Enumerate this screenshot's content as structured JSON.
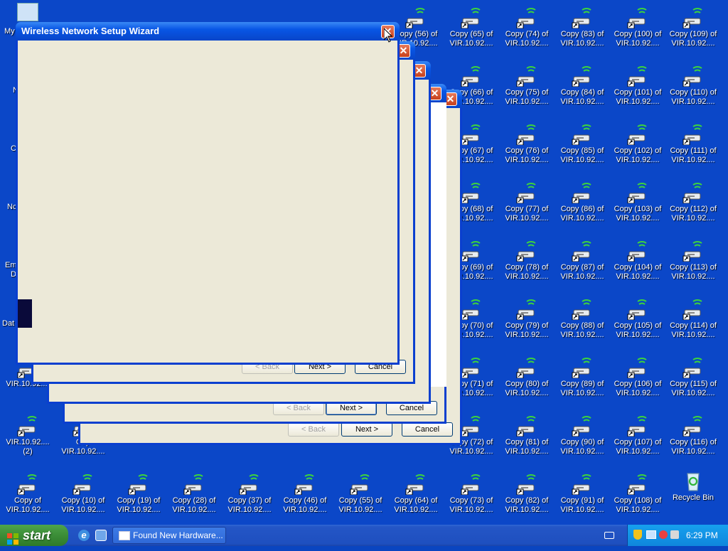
{
  "desktop": {
    "partial_labels": [
      "My",
      "N",
      "C",
      "Nc",
      "Em",
      "D",
      "Dat"
    ],
    "icons_row1": [
      "Copy (56) of",
      "Copy (65) of",
      "Copy (74) of",
      "Copy (83) of",
      "Copy (100) of",
      "Copy (109) of"
    ],
    "icons_col_y": [
      [
        "Copy (66) of",
        "Copy (75) of",
        "Copy (84) of",
        "Copy (101) of",
        "Copy (110) of"
      ],
      [
        "Copy (67) of",
        "Copy (76) of",
        "Copy (85) of",
        "Copy (102) of",
        "Copy (111) of"
      ],
      [
        "Copy (68) of",
        "Copy (77) of",
        "Copy (86) of",
        "Copy (103) of",
        "Copy (112) of"
      ],
      [
        "Copy (69) of",
        "Copy (78) of",
        "Copy (87) of",
        "Copy (104) of",
        "Copy (113) of"
      ],
      [
        "Copy (70) of",
        "Copy (79) of",
        "Copy (88) of",
        "Copy (105) of",
        "Copy (114) of"
      ],
      [
        "Copy (71) of",
        "Copy (80) of",
        "Copy (89) of",
        "Copy (106) of",
        "Copy (115) of"
      ],
      [
        "Copy (72) of",
        "Copy (81) of",
        "Copy (90) of",
        "Copy (107) of",
        "Copy (116) of"
      ]
    ],
    "bottom_row": [
      "Copy of",
      "Copy (10) of",
      "Copy (19) of",
      "Copy (28) of",
      "Copy (37) of",
      "Copy (46) of",
      "Copy (55) of",
      "Copy (64) of",
      "Copy (73) of",
      "Copy (82) of",
      "Copy (91) of",
      "Copy (108) of"
    ],
    "subline": "VIR.10.92....",
    "row8_first_sub": "(2)",
    "row8_second_label": "Cop",
    "row7_first": "VIR.10.92....",
    "recycle_bin": "Recycle Bin"
  },
  "wizard": {
    "title": "Wireless Network Setup Wizard",
    "back": "< Back",
    "next": "Next >",
    "cancel": "Cancel"
  },
  "taskbar": {
    "start": "start",
    "task": "Found New Hardware...",
    "clock": "6:29 PM"
  }
}
